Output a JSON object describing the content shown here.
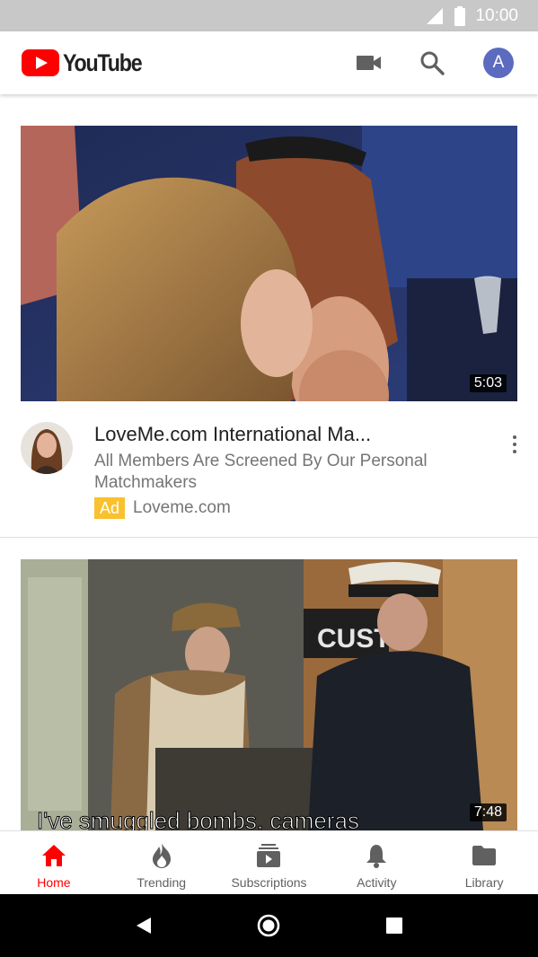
{
  "status_bar": {
    "time": "10:00"
  },
  "app_bar": {
    "logo_text": "YouTube",
    "brand_red": "#ff0000",
    "avatar_initial": "A",
    "avatar_color": "#5c6bc0",
    "icons": [
      "camera-icon",
      "search-icon"
    ]
  },
  "feed": [
    {
      "duration": "5:03",
      "title": "LoveMe.com International Ma...",
      "description": "All Members Are Screened By Our Personal Matchmakers",
      "badge": "Ad",
      "advertiser": "Loveme.com"
    },
    {
      "duration": "7:48",
      "sign_text": "CUST",
      "subtitle_text": "I've smuggled bombs, cameras"
    }
  ],
  "bottom_nav": {
    "items": [
      {
        "label": "Home",
        "icon": "home-icon",
        "active": true
      },
      {
        "label": "Trending",
        "icon": "flame-icon",
        "active": false
      },
      {
        "label": "Subscriptions",
        "icon": "subscriptions-icon",
        "active": false
      },
      {
        "label": "Activity",
        "icon": "bell-icon",
        "active": false
      },
      {
        "label": "Library",
        "icon": "folder-icon",
        "active": false
      }
    ],
    "active_color": "#ff0000",
    "inactive_color": "#606060"
  },
  "system_nav": {
    "icons": [
      "back-icon",
      "home-circle-icon",
      "recents-icon"
    ]
  }
}
